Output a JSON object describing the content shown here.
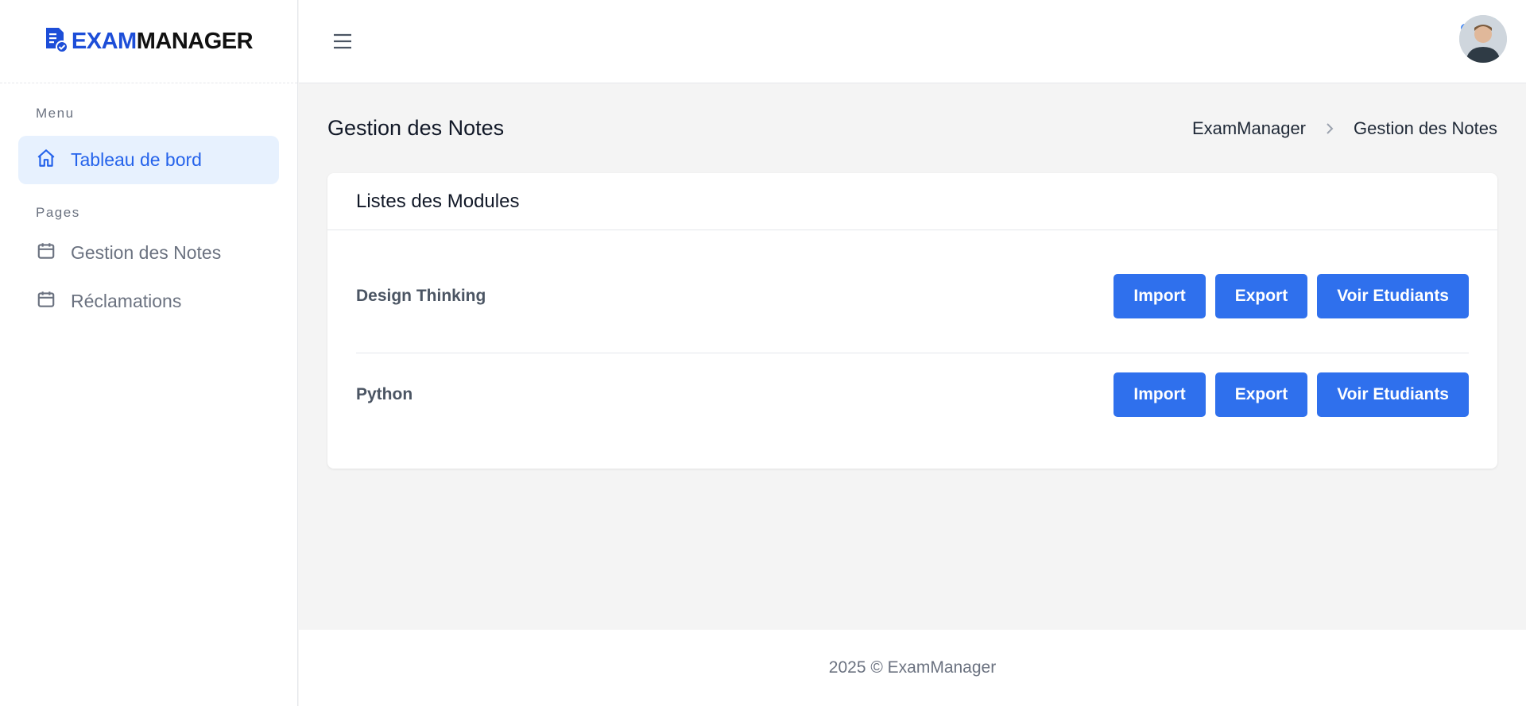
{
  "brand": {
    "name_part1": "EXAM",
    "name_part2": "MANAGER",
    "logo_icon": "document-check-icon",
    "accent_color": "#1d4ed8"
  },
  "sidebar": {
    "menu_label": "Menu",
    "pages_label": "Pages",
    "items": [
      {
        "label": "Tableau de bord",
        "icon": "home-icon",
        "active": true
      },
      {
        "label": "Gestion des Notes",
        "icon": "calendar-icon",
        "active": false
      },
      {
        "label": "Réclamations",
        "icon": "calendar-icon",
        "active": false
      }
    ]
  },
  "topbar": {
    "menu_toggle_icon": "hamburger-icon",
    "avatar_icon": "user-avatar"
  },
  "page": {
    "title": "Gestion des Notes",
    "breadcrumb": [
      "ExamManager",
      "Gestion des Notes"
    ]
  },
  "card": {
    "title": "Listes des Modules",
    "modules": [
      {
        "name": "Design Thinking",
        "buttons": [
          "Import",
          "Export",
          "Voir Etudiants"
        ]
      },
      {
        "name": "Python",
        "buttons": [
          "Import",
          "Export",
          "Voir Etudiants"
        ]
      }
    ]
  },
  "footer": {
    "text": "2025 © ExamManager"
  },
  "colors": {
    "primary_button": "#2f70ed",
    "active_nav_bg": "#e7f1fe",
    "active_nav_text": "#2563eb",
    "page_bg": "#f4f4f4"
  }
}
